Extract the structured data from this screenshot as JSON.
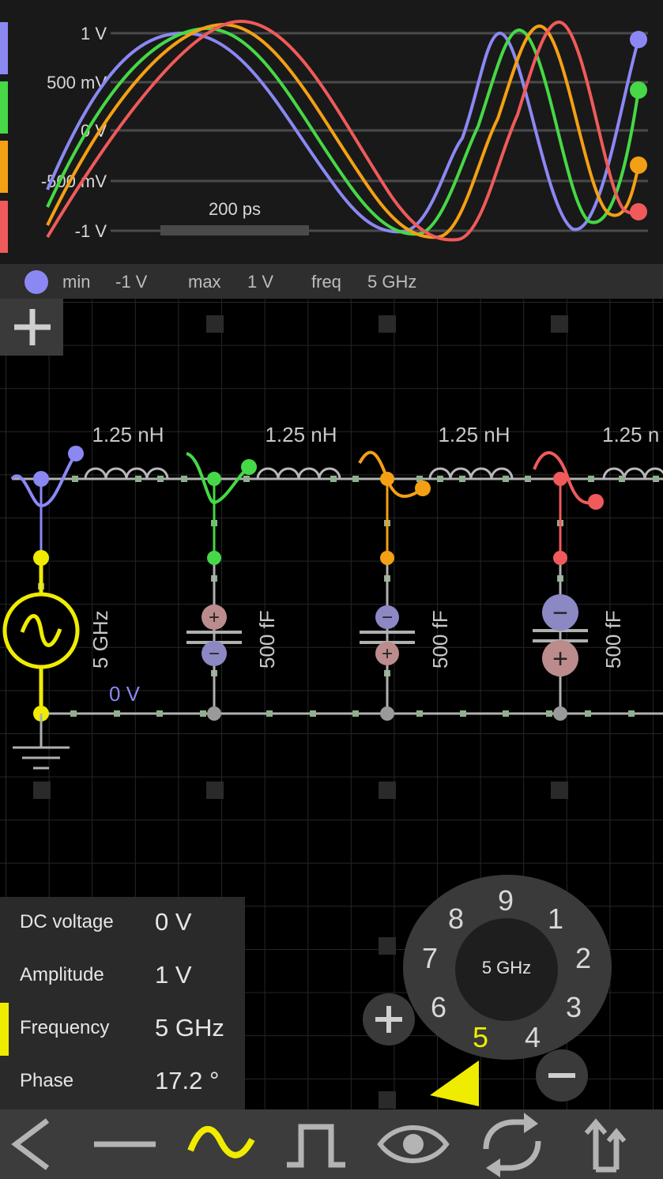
{
  "scope": {
    "y_ticks": [
      "1 V",
      "500 mV",
      "0 V",
      "-500 mV",
      "-1 V"
    ],
    "time_scale_label": "200 ps",
    "trace_colors": [
      "#8b88f4",
      "#46d846",
      "#f4a014",
      "#f05a5a"
    ]
  },
  "info_bar": {
    "min_label": "min",
    "min_value": "-1 V",
    "max_label": "max",
    "max_value": "1 V",
    "freq_label": "freq",
    "freq_value": "5 GHz",
    "probe_color": "#8b88f4"
  },
  "circuit": {
    "inductors": [
      "1.25 nH",
      "1.25 nH",
      "1.25 nH",
      "1.25 n"
    ],
    "capacitors": [
      "500 fF",
      "500 fF",
      "500 fF"
    ],
    "source_label": "5 GHz",
    "ground_label": "0 V"
  },
  "properties": [
    {
      "label": "DC voltage",
      "value": "0 V"
    },
    {
      "label": "Amplitude",
      "value": "1 V"
    },
    {
      "label": "Frequency",
      "value": "5 GHz",
      "selected": true
    },
    {
      "label": "Phase",
      "value": "17.2 °"
    }
  ],
  "dial": {
    "center_value": "5 GHz",
    "digits": [
      "9",
      "1",
      "2",
      "3",
      "4",
      "5",
      "6",
      "7",
      "8"
    ],
    "selected_digit": "5"
  },
  "toolbar": {
    "icons": [
      "back-icon",
      "wire-icon",
      "sine-source-icon",
      "pulse-source-icon",
      "eye-icon",
      "rotate-icon",
      "flip-icon"
    ],
    "active": "sine-source-icon",
    "accent": "#f0ec00"
  }
}
